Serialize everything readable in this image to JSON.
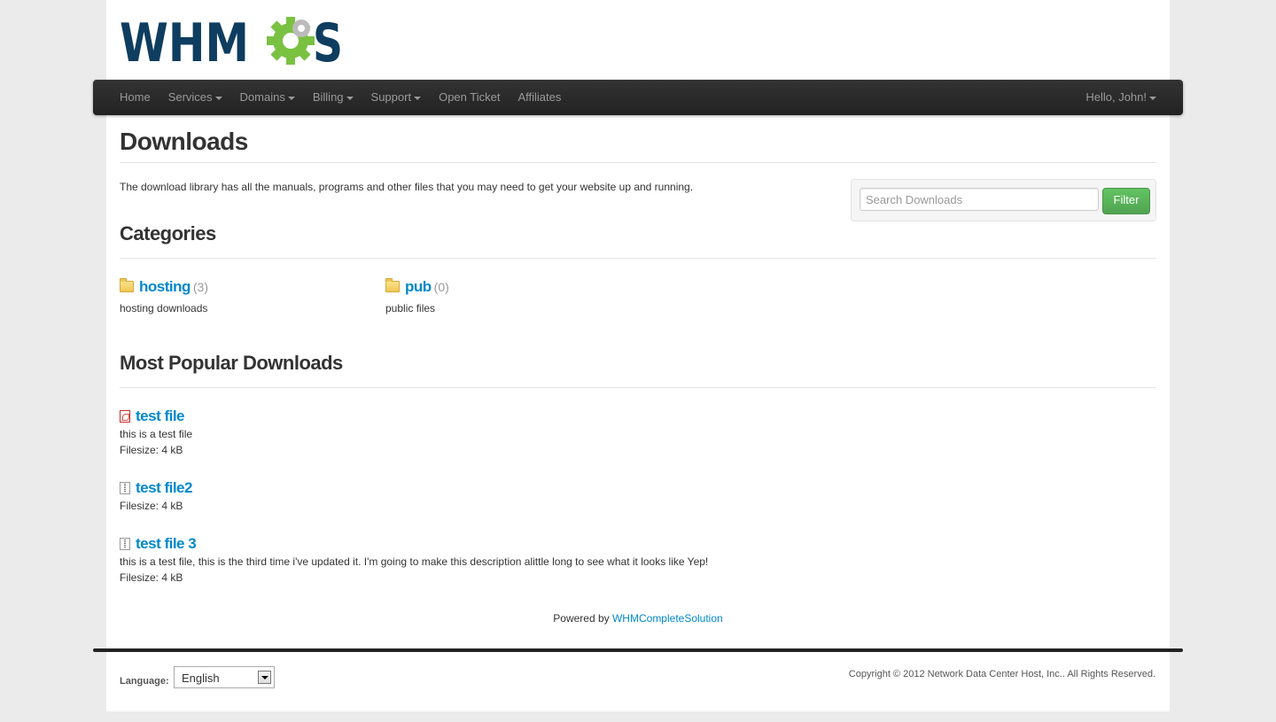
{
  "logo": {
    "text": "WHMCS"
  },
  "nav": {
    "items": [
      {
        "label": "Home",
        "dropdown": false
      },
      {
        "label": "Services",
        "dropdown": true
      },
      {
        "label": "Domains",
        "dropdown": true
      },
      {
        "label": "Billing",
        "dropdown": true
      },
      {
        "label": "Support",
        "dropdown": true
      },
      {
        "label": "Open Ticket",
        "dropdown": false
      },
      {
        "label": "Affiliates",
        "dropdown": false
      }
    ],
    "user": "Hello, John!"
  },
  "page": {
    "title": "Downloads",
    "intro": "The download library has all the manuals, programs and other files that you may need to get your website up and running."
  },
  "search": {
    "placeholder": "Search Downloads",
    "value": "",
    "button": "Filter"
  },
  "categories": {
    "heading": "Categories",
    "items": [
      {
        "name": "hosting",
        "count": "(3)",
        "description": "hosting downloads"
      },
      {
        "name": "pub",
        "count": "(0)",
        "description": "public files"
      }
    ]
  },
  "popular": {
    "heading": "Most Popular Downloads",
    "items": [
      {
        "title": "test file",
        "icon": "pdf-icon",
        "description": "this is a test file",
        "filesize": "Filesize: 4 kB"
      },
      {
        "title": "test file2",
        "icon": "zip-icon",
        "description": "",
        "filesize": "Filesize: 4 kB"
      },
      {
        "title": "test file 3",
        "icon": "zip-icon",
        "description": "this is a test file, this is the third time i've updated it. I'm going to make this description alittle long to see what it looks like Yep!",
        "filesize": "Filesize: 4 kB"
      }
    ]
  },
  "footer": {
    "powered_prefix": "Powered by ",
    "powered_link": "WHMCompleteSolution",
    "language_label": "Language:",
    "language_value": "English",
    "copyright": "Copyright © 2012 Network Data Center Host, Inc.. All Rights Reserved."
  },
  "colors": {
    "link": "#0088cc",
    "navbar": "#222222",
    "filter_button": "#5bb75b",
    "logo_blue": "#0e3d5f",
    "logo_green": "#7ac142"
  }
}
